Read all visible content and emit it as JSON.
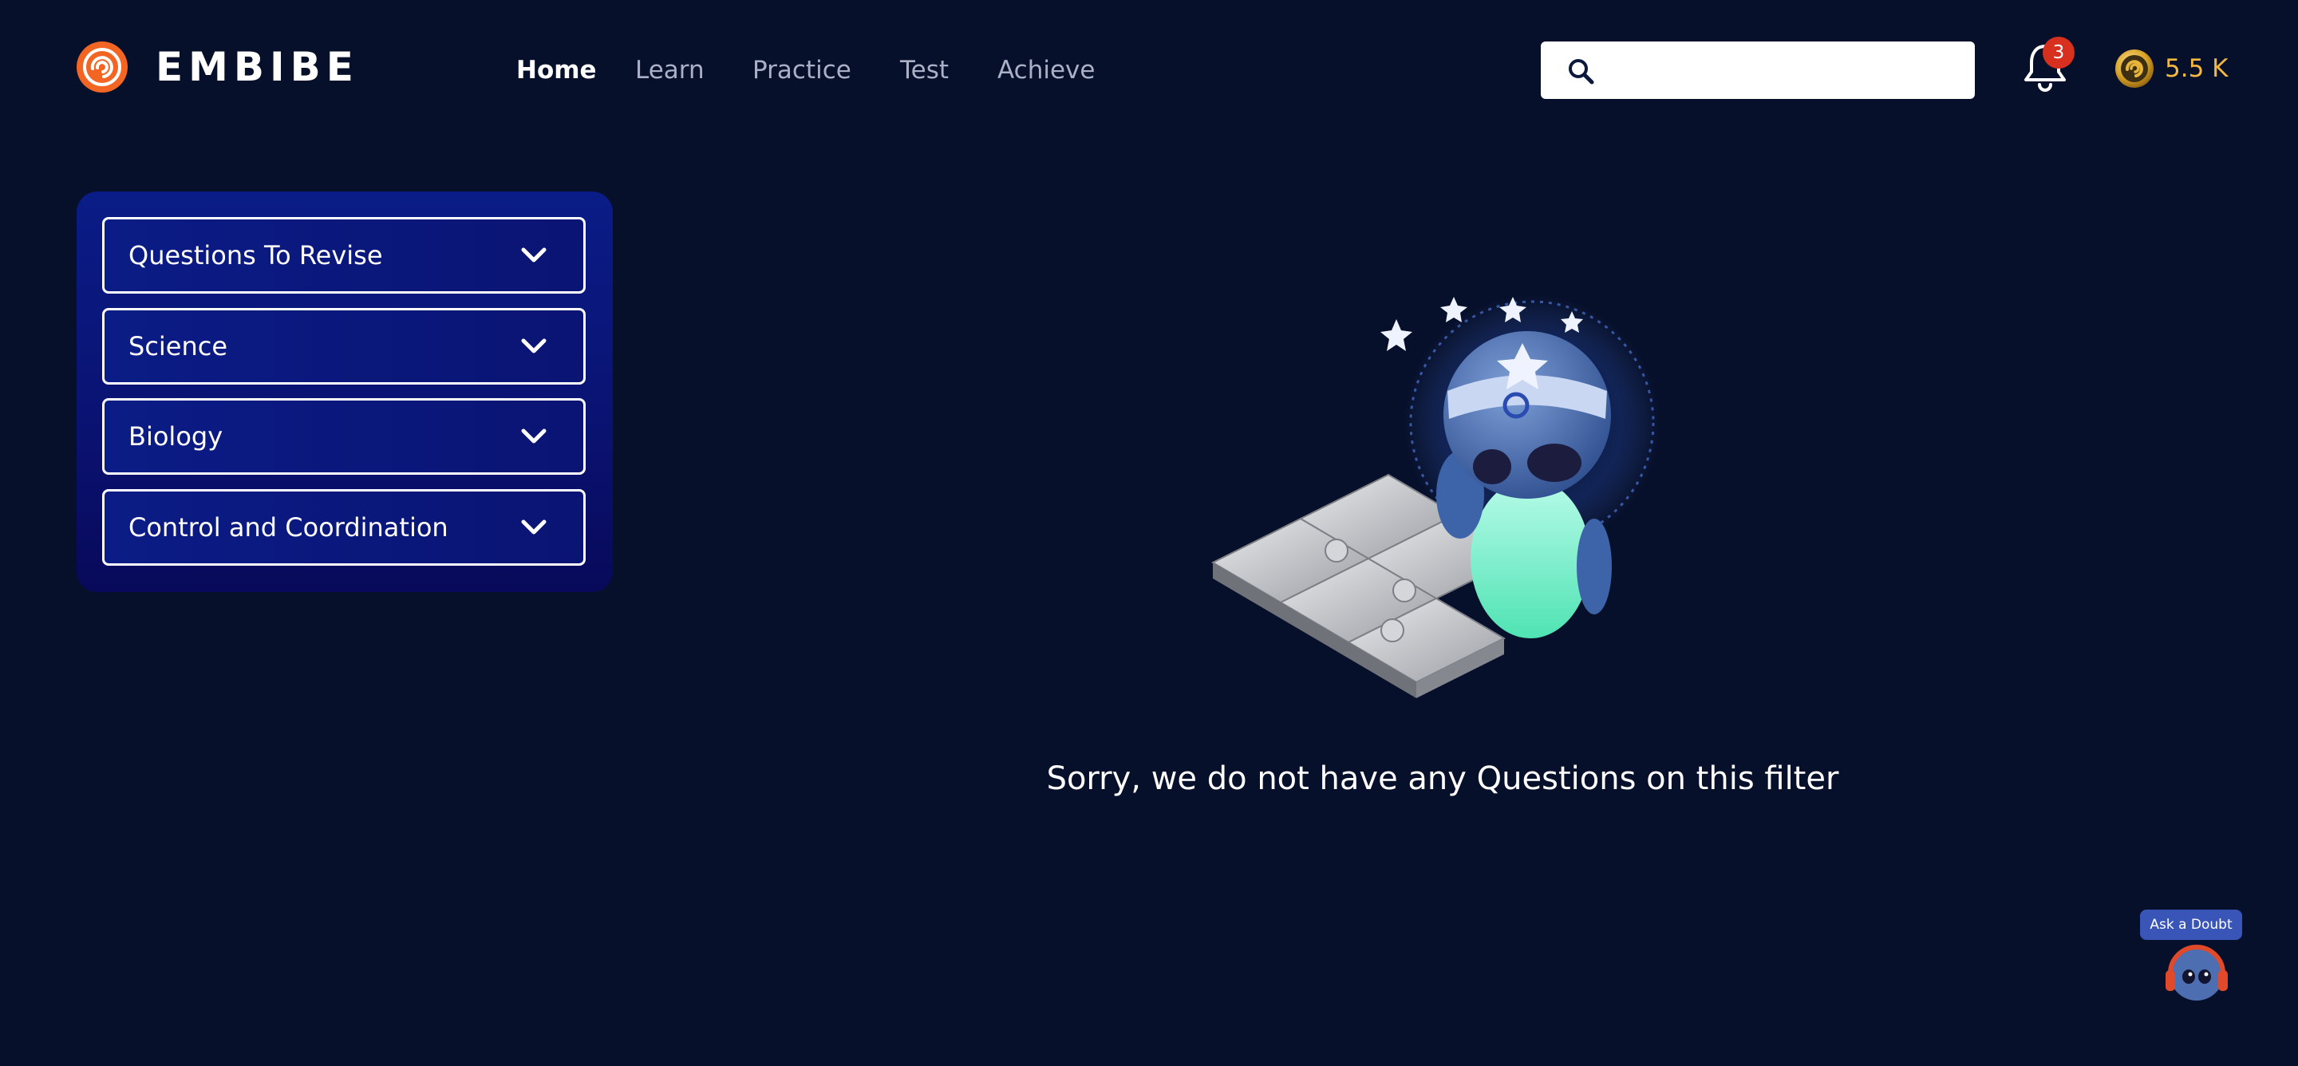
{
  "header": {
    "brand_name": "EMBIBE",
    "nav": [
      {
        "label": "Home",
        "active": true
      },
      {
        "label": "Learn",
        "active": false
      },
      {
        "label": "Practice",
        "active": false
      },
      {
        "label": "Test",
        "active": false
      },
      {
        "label": "Achieve",
        "active": false
      }
    ],
    "search": {
      "value": "",
      "placeholder": ""
    },
    "notifications_count": "3",
    "coins": "5.5 K"
  },
  "filters": [
    {
      "label": "Questions To Revise"
    },
    {
      "label": "Science"
    },
    {
      "label": "Biology"
    },
    {
      "label": "Control and Coordination"
    }
  ],
  "main": {
    "empty_message": "Sorry, we do not have any Questions on this filter"
  },
  "ask_doubt": {
    "label": "Ask a Doubt"
  },
  "colors": {
    "background": "#07102b",
    "panel": "#0a1873",
    "brand_orange": "#f26522",
    "coin_gold": "#f4b740",
    "badge_red": "#d7301f"
  },
  "icons": [
    "embibe-logo-icon",
    "search-icon",
    "bell-icon",
    "coin-icon",
    "chevron-down-icon",
    "robot-mascot-icon"
  ]
}
